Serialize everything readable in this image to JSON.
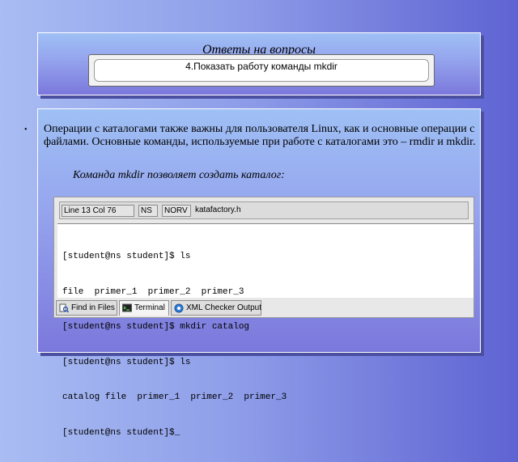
{
  "slide": {
    "title": "Ответы на вопросы",
    "question": "4.Показать работу команды mkdir",
    "bullet": "•",
    "paragraph": "Операции с  каталогами также важны для пользователя Linux, как и основные операции с файлами. Основные команды, используемые при работе с каталогами это – rmdir и mkdir.",
    "caption": "Команда mkdir позволяет создать каталог:"
  },
  "editor": {
    "status": {
      "position": "Line 13 Col 76",
      "mode1": "NS",
      "mode2": "NORV",
      "file": "katafactory.h"
    },
    "terminal_lines": [
      "[student@ns student]$ ls",
      "file  primer_1  primer_2  primer_3",
      "[student@ns student]$ mkdir catalog",
      "[student@ns student]$ ls",
      "catalog file  primer_1  primer_2  primer_3",
      "[student@ns student]$_"
    ],
    "tabs": [
      {
        "label": "Find in Files",
        "icon": "find-in-files-icon"
      },
      {
        "label": "Terminal",
        "icon": "terminal-icon"
      },
      {
        "label": "XML Checker Output",
        "icon": "xml-checker-icon"
      }
    ]
  }
}
